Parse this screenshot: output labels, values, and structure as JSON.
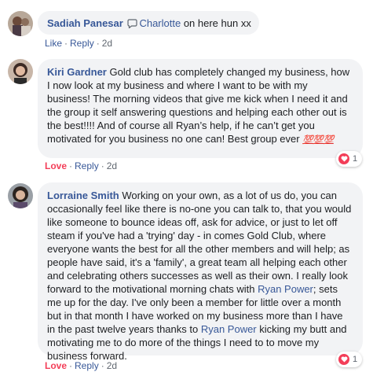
{
  "comments": [
    {
      "author": "Sadiah Panesar",
      "mention": "Charlotte",
      "text": " on here hun xx",
      "actions": {
        "like": "Like",
        "reply": "Reply",
        "time": "2d"
      }
    },
    {
      "author": "Kiri Gardner",
      "text": " Gold club has completely changed my business, how I now look at my business and where I want to be with my business! The morning videos that give me kick when I need it and the group it self answering questions and helping each other out is the best!!!! And of course all Ryan’s help, if he can’t get you motivated for you business no one can! Best group ever ",
      "emoji": "💯💯💯",
      "actions": {
        "reaction": "Love",
        "reply": "Reply",
        "time": "2d"
      },
      "reaction_count": "1"
    },
    {
      "author": "Lorraine Smith",
      "text_part1": " Working on your own, as a lot of us do, you can occasionally feel like there is no-one you can talk to, that you would like someone to bounce ideas off, ask for advice, or just to let off steam if you've had a 'trying' day - in comes Gold Club, where everyone wants the best for all the other members and will help; as people have said, it's a 'family', a great team all helping each other and celebrating others successes as well as their own. I really look forward to the motivational morning chats with ",
      "mention1": "Ryan Power",
      "text_part2": "; sets me up for the day. I've only been a member for little over a month but in that month I have worked on my business more than I have in the past twelve years thanks to ",
      "mention2": "Ryan Power",
      "text_part3": " kicking my butt and motivating me to do more of the things I need to to move my business forward.",
      "actions": {
        "reaction": "Love",
        "reply": "Reply",
        "time": "2d"
      },
      "reaction_count": "1"
    }
  ],
  "colors": {
    "link": "#385898",
    "love": "#f33e58",
    "bubble": "#f2f3f5",
    "meta": "#606770"
  },
  "icons": [
    "messenger-icon",
    "heart-reaction-icon",
    "hundred-points-emoji"
  ]
}
